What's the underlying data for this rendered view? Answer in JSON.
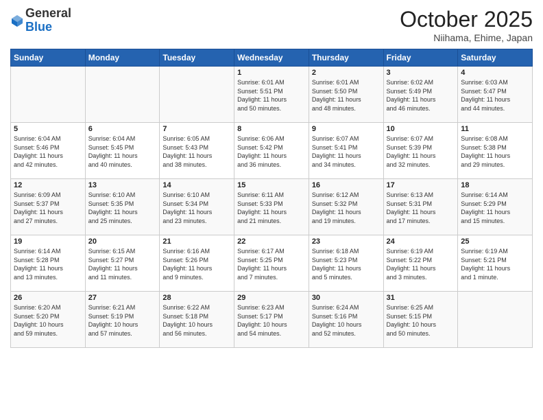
{
  "logo": {
    "general": "General",
    "blue": "Blue"
  },
  "header": {
    "title": "October 2025",
    "subtitle": "Niihama, Ehime, Japan"
  },
  "weekdays": [
    "Sunday",
    "Monday",
    "Tuesday",
    "Wednesday",
    "Thursday",
    "Friday",
    "Saturday"
  ],
  "weeks": [
    [
      {
        "day": "",
        "info": ""
      },
      {
        "day": "",
        "info": ""
      },
      {
        "day": "",
        "info": ""
      },
      {
        "day": "1",
        "info": "Sunrise: 6:01 AM\nSunset: 5:51 PM\nDaylight: 11 hours\nand 50 minutes."
      },
      {
        "day": "2",
        "info": "Sunrise: 6:01 AM\nSunset: 5:50 PM\nDaylight: 11 hours\nand 48 minutes."
      },
      {
        "day": "3",
        "info": "Sunrise: 6:02 AM\nSunset: 5:49 PM\nDaylight: 11 hours\nand 46 minutes."
      },
      {
        "day": "4",
        "info": "Sunrise: 6:03 AM\nSunset: 5:47 PM\nDaylight: 11 hours\nand 44 minutes."
      }
    ],
    [
      {
        "day": "5",
        "info": "Sunrise: 6:04 AM\nSunset: 5:46 PM\nDaylight: 11 hours\nand 42 minutes."
      },
      {
        "day": "6",
        "info": "Sunrise: 6:04 AM\nSunset: 5:45 PM\nDaylight: 11 hours\nand 40 minutes."
      },
      {
        "day": "7",
        "info": "Sunrise: 6:05 AM\nSunset: 5:43 PM\nDaylight: 11 hours\nand 38 minutes."
      },
      {
        "day": "8",
        "info": "Sunrise: 6:06 AM\nSunset: 5:42 PM\nDaylight: 11 hours\nand 36 minutes."
      },
      {
        "day": "9",
        "info": "Sunrise: 6:07 AM\nSunset: 5:41 PM\nDaylight: 11 hours\nand 34 minutes."
      },
      {
        "day": "10",
        "info": "Sunrise: 6:07 AM\nSunset: 5:39 PM\nDaylight: 11 hours\nand 32 minutes."
      },
      {
        "day": "11",
        "info": "Sunrise: 6:08 AM\nSunset: 5:38 PM\nDaylight: 11 hours\nand 29 minutes."
      }
    ],
    [
      {
        "day": "12",
        "info": "Sunrise: 6:09 AM\nSunset: 5:37 PM\nDaylight: 11 hours\nand 27 minutes."
      },
      {
        "day": "13",
        "info": "Sunrise: 6:10 AM\nSunset: 5:35 PM\nDaylight: 11 hours\nand 25 minutes."
      },
      {
        "day": "14",
        "info": "Sunrise: 6:10 AM\nSunset: 5:34 PM\nDaylight: 11 hours\nand 23 minutes."
      },
      {
        "day": "15",
        "info": "Sunrise: 6:11 AM\nSunset: 5:33 PM\nDaylight: 11 hours\nand 21 minutes."
      },
      {
        "day": "16",
        "info": "Sunrise: 6:12 AM\nSunset: 5:32 PM\nDaylight: 11 hours\nand 19 minutes."
      },
      {
        "day": "17",
        "info": "Sunrise: 6:13 AM\nSunset: 5:31 PM\nDaylight: 11 hours\nand 17 minutes."
      },
      {
        "day": "18",
        "info": "Sunrise: 6:14 AM\nSunset: 5:29 PM\nDaylight: 11 hours\nand 15 minutes."
      }
    ],
    [
      {
        "day": "19",
        "info": "Sunrise: 6:14 AM\nSunset: 5:28 PM\nDaylight: 11 hours\nand 13 minutes."
      },
      {
        "day": "20",
        "info": "Sunrise: 6:15 AM\nSunset: 5:27 PM\nDaylight: 11 hours\nand 11 minutes."
      },
      {
        "day": "21",
        "info": "Sunrise: 6:16 AM\nSunset: 5:26 PM\nDaylight: 11 hours\nand 9 minutes."
      },
      {
        "day": "22",
        "info": "Sunrise: 6:17 AM\nSunset: 5:25 PM\nDaylight: 11 hours\nand 7 minutes."
      },
      {
        "day": "23",
        "info": "Sunrise: 6:18 AM\nSunset: 5:23 PM\nDaylight: 11 hours\nand 5 minutes."
      },
      {
        "day": "24",
        "info": "Sunrise: 6:19 AM\nSunset: 5:22 PM\nDaylight: 11 hours\nand 3 minutes."
      },
      {
        "day": "25",
        "info": "Sunrise: 6:19 AM\nSunset: 5:21 PM\nDaylight: 11 hours\nand 1 minute."
      }
    ],
    [
      {
        "day": "26",
        "info": "Sunrise: 6:20 AM\nSunset: 5:20 PM\nDaylight: 10 hours\nand 59 minutes."
      },
      {
        "day": "27",
        "info": "Sunrise: 6:21 AM\nSunset: 5:19 PM\nDaylight: 10 hours\nand 57 minutes."
      },
      {
        "day": "28",
        "info": "Sunrise: 6:22 AM\nSunset: 5:18 PM\nDaylight: 10 hours\nand 56 minutes."
      },
      {
        "day": "29",
        "info": "Sunrise: 6:23 AM\nSunset: 5:17 PM\nDaylight: 10 hours\nand 54 minutes."
      },
      {
        "day": "30",
        "info": "Sunrise: 6:24 AM\nSunset: 5:16 PM\nDaylight: 10 hours\nand 52 minutes."
      },
      {
        "day": "31",
        "info": "Sunrise: 6:25 AM\nSunset: 5:15 PM\nDaylight: 10 hours\nand 50 minutes."
      },
      {
        "day": "",
        "info": ""
      }
    ]
  ]
}
